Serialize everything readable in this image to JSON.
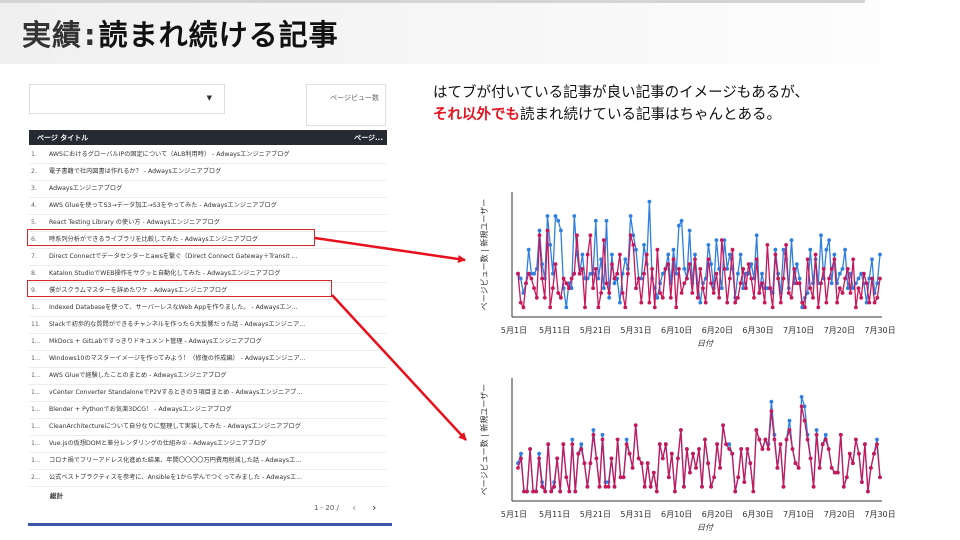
{
  "header": {
    "title_prefix": "実績",
    "title_separator": ":",
    "title_main": "読まれ続ける記事"
  },
  "report": {
    "pageviews_label": "ページビュー数",
    "column_title": "ページ タイトル",
    "column_metric": "ページ...",
    "total_label": "総計",
    "pager_text": "1 - 20 /",
    "prev_icon": "chevron-left-icon",
    "next_icon": "chevron-right-icon",
    "rows": [
      {
        "num": "1.",
        "title": "AWSにおけるグローバルIPの固定について（ALB利用時） - Adwaysエンジニアブログ"
      },
      {
        "num": "2.",
        "title": "電子書籍で社内図書は作れるか？ - Adwaysエンジニアブログ"
      },
      {
        "num": "3.",
        "title": "Adwaysエンジニアブログ"
      },
      {
        "num": "4.",
        "title": "AWS Glueを使ってS3→データ加工→S3をやってみた - Adwaysエンジニアブログ"
      },
      {
        "num": "5.",
        "title": "React Testing Library の使い方 - Adwaysエンジニアブログ"
      },
      {
        "num": "6.",
        "title": "時系列分析ができるライブラリを比較してみた - Adwaysエンジニアブログ"
      },
      {
        "num": "7.",
        "title": "Direct Connectでデータセンターとawsを繋ぐ（Direct Connect Gateway＋Transit ..."
      },
      {
        "num": "8.",
        "title": "Katalon StudioでWEB操作をサクッと自動化してみた - Adwaysエンジニアブログ"
      },
      {
        "num": "9.",
        "title": "僕がスクラムマスターを辞めたワケ - Adwaysエンジニアブログ"
      },
      {
        "num": "1...",
        "title": "Indexed Databaseを使って、サーバーレスなWeb Appを作りました。 - Adwaysエン..."
      },
      {
        "num": "11.",
        "title": "Slackで初歩的な質問ができるチャンネルを作ったら大反響だった話 - Adwaysエンジニア..."
      },
      {
        "num": "1...",
        "title": "MkDocs + GitLabですっきりドキュメント管理 - Adwaysエンジニアブログ"
      },
      {
        "num": "1...",
        "title": "Windows10のマスターイメージを作ってみよう！（修復の作成編） - Adwaysエンジニア..."
      },
      {
        "num": "1...",
        "title": "AWS Glueで経験したことのまとめ - Adwaysエンジニアブログ"
      },
      {
        "num": "1...",
        "title": "vCenter Converter StandaloneでP2Vするときの９項目まとめ - Adwaysエンジニアブ..."
      },
      {
        "num": "1...",
        "title": "Blender + Pythonでお気楽3DCG！ - Adwaysエンジニアブログ"
      },
      {
        "num": "1...",
        "title": "CleanArchitectureについて自分なりに整理して実装してみた - Adwaysエンジニアブログ"
      },
      {
        "num": "1...",
        "title": "Vue.jsの仮想DOMと差分レンダリングの仕組み① - Adwaysエンジニアブログ"
      },
      {
        "num": "1...",
        "title": "コロナ禍でフリーアドレス化進めた結果、年間〇〇〇〇万円費用削減した話 - Adwaysエ..."
      },
      {
        "num": "2...",
        "title": "公式ベストプラクティスを参考に、Ansibleを1から学んでつくってみました - Adwaysエ..."
      }
    ]
  },
  "note": {
    "line1": "はてブが付いている記事が良い記事のイメージもあるが、",
    "line2_emph": "それ以外でも",
    "line2_rest": "読まれ続けている記事はちゃんとある。"
  },
  "colors": {
    "highlight": "#d62828",
    "arrow": "#e8101c",
    "pageviews_series": "#2f7fe0",
    "new_users_series": "#c8185a",
    "table_header": "#262b33"
  },
  "chart_data": [
    {
      "type": "line",
      "xlabel": "日付",
      "ylabel": "ページビュー数 | 新規ユーザー",
      "x_ticks": [
        "5月1日",
        "5月11日",
        "5月21日",
        "5月31日",
        "6月10日",
        "6月20日",
        "6月30日",
        "7月10日",
        "7月20日",
        "7月30日"
      ],
      "ylim": [
        0,
        26
      ],
      "series": [
        {
          "values": [
            9,
            8,
            5,
            7,
            14,
            9,
            9,
            10,
            18,
            11,
            8,
            21,
            15,
            9,
            21,
            20,
            18,
            6,
            2,
            7,
            6,
            21,
            13,
            9,
            13,
            8,
            8,
            9,
            9,
            20,
            8,
            12,
            6,
            20,
            4,
            13,
            7,
            8,
            3,
            9,
            12,
            10,
            21,
            17,
            14,
            8,
            8,
            15,
            11,
            24,
            8,
            6,
            4,
            7,
            9,
            10,
            13,
            7,
            14,
            9,
            19,
            20,
            10,
            8,
            18,
            7,
            13,
            7,
            3,
            7,
            8,
            15,
            11,
            6,
            16,
            10,
            6,
            16,
            10,
            13,
            10,
            4,
            9,
            13,
            6,
            9,
            9,
            11,
            8,
            17,
            5,
            9,
            6,
            6,
            6,
            5,
            14,
            9,
            5,
            14,
            12,
            6,
            16,
            7,
            11,
            8,
            2,
            4,
            5,
            14,
            7,
            12,
            7,
            17,
            8,
            14,
            16,
            7,
            13,
            7,
            9,
            10,
            14,
            6,
            9,
            6,
            7,
            8,
            9,
            7,
            3,
            8,
            12,
            5,
            7,
            13
          ]
        },
        {
          "values": [
            9,
            3,
            2,
            7,
            9,
            8,
            6,
            4,
            17,
            8,
            4,
            18,
            2,
            6,
            11,
            5,
            4,
            8,
            7,
            6,
            8,
            9,
            17,
            9,
            10,
            2,
            13,
            17,
            6,
            10,
            2,
            5,
            16,
            7,
            5,
            11,
            8,
            9,
            13,
            5,
            2,
            9,
            17,
            15,
            6,
            8,
            3,
            9,
            13,
            3,
            10,
            2,
            14,
            5,
            4,
            10,
            11,
            4,
            12,
            2,
            10,
            5,
            7,
            8,
            11,
            5,
            12,
            4,
            10,
            6,
            3,
            12,
            7,
            5,
            9,
            4,
            16,
            10,
            3,
            8,
            14,
            3,
            4,
            7,
            10,
            6,
            11,
            8,
            4,
            12,
            5,
            7,
            3,
            15,
            6,
            2,
            13,
            8,
            3,
            8,
            15,
            5,
            4,
            10,
            7,
            7,
            3,
            2,
            12,
            6,
            4,
            13,
            2,
            7,
            10,
            3,
            8,
            10,
            12,
            3,
            6,
            5,
            8,
            10,
            5,
            12,
            2,
            6,
            4,
            9,
            7,
            3,
            8,
            3,
            4,
            8
          ]
        }
      ]
    },
    {
      "type": "line",
      "xlabel": "日付",
      "ylabel": "ページビュー数 | 新規ユーザー",
      "x_ticks": [
        "5月1日",
        "5月11日",
        "5月21日",
        "5月31日",
        "6月10日",
        "6月20日",
        "6月30日",
        "7月10日",
        "7月20日",
        "7月30日"
      ],
      "ylim": [
        0,
        26
      ],
      "series": [
        {
          "values": [
            8,
            10,
            2,
            2,
            11,
            2,
            2,
            10,
            4,
            2,
            12,
            2,
            4,
            9,
            2,
            12,
            5,
            2,
            13,
            2,
            10,
            12,
            8,
            3,
            8,
            15,
            9,
            3,
            14,
            4,
            4,
            9,
            3,
            13,
            5,
            5,
            13,
            10,
            7,
            16,
            9,
            8,
            3,
            8,
            3,
            6,
            2,
            12,
            9,
            12,
            5,
            10,
            2,
            9,
            15,
            3,
            11,
            6,
            10,
            7,
            11,
            3,
            13,
            8,
            3,
            5,
            12,
            7,
            16,
            12,
            12,
            10,
            2,
            5,
            11,
            4,
            11,
            8,
            2,
            15,
            13,
            11,
            13,
            12,
            21,
            14,
            7,
            12,
            3,
            13,
            17,
            11,
            8,
            7,
            22,
            20,
            14,
            9,
            3,
            15,
            7,
            12,
            14,
            11,
            7,
            6,
            6,
            14,
            3,
            5,
            10,
            8,
            13,
            10,
            4,
            12,
            2,
            7,
            10,
            13,
            5
          ]
        },
        {
          "values": [
            7,
            9,
            2,
            2,
            11,
            2,
            2,
            9,
            3,
            2,
            12,
            2,
            3,
            9,
            2,
            12,
            5,
            2,
            12,
            2,
            10,
            11,
            8,
            3,
            8,
            14,
            9,
            3,
            13,
            3,
            3,
            9,
            3,
            13,
            5,
            5,
            12,
            10,
            7,
            16,
            9,
            8,
            3,
            8,
            3,
            6,
            2,
            12,
            9,
            12,
            5,
            10,
            2,
            9,
            15,
            3,
            11,
            6,
            10,
            7,
            11,
            3,
            13,
            8,
            3,
            5,
            12,
            7,
            16,
            12,
            11,
            10,
            2,
            5,
            11,
            4,
            11,
            8,
            2,
            15,
            13,
            11,
            13,
            11,
            19,
            13,
            7,
            12,
            3,
            13,
            15,
            11,
            8,
            7,
            20,
            17,
            13,
            9,
            3,
            14,
            7,
            12,
            13,
            11,
            7,
            6,
            6,
            14,
            3,
            5,
            10,
            8,
            13,
            10,
            4,
            12,
            2,
            7,
            10,
            12,
            5
          ]
        }
      ]
    }
  ]
}
